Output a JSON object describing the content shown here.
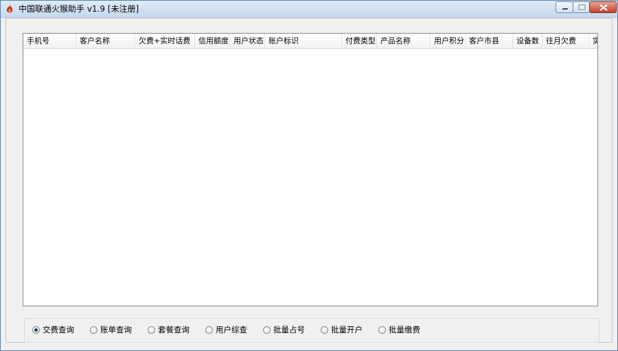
{
  "window": {
    "title": "中国联通火猴助手 v1.9 [未注册]"
  },
  "list": {
    "columns": [
      "手机号",
      "客户名称",
      "欠费+实时话费",
      "信用额度",
      "用户状态",
      "账户标识",
      "付费类型",
      "产品名称",
      "用户积分",
      "客户市县",
      "设备数",
      "往月欠费",
      "实"
    ],
    "rows": []
  },
  "query_modes": {
    "options": [
      "交费查询",
      "账单查询",
      "套餐查询",
      "用户综查",
      "批量占号",
      "批量开户",
      "批量缴费"
    ],
    "selected": "交费查询"
  },
  "colors": {
    "selected_dot": "#1d3e74",
    "close_button": "#c7402b",
    "titlebar": "#c7d9ee"
  }
}
